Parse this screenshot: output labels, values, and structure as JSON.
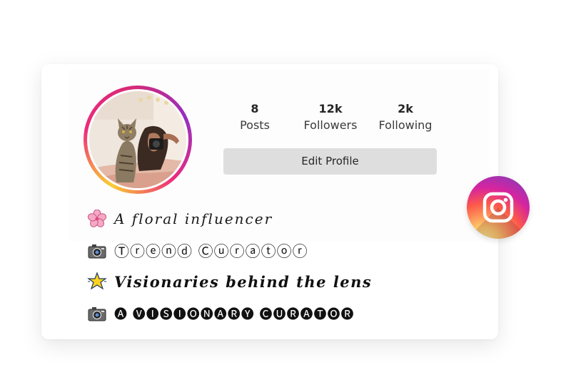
{
  "profile": {
    "stats": [
      {
        "value": "8",
        "label": "Posts"
      },
      {
        "value": "12k",
        "label": "Followers"
      },
      {
        "value": "2k",
        "label": "Following"
      }
    ],
    "edit_button_label": "Edit Profile",
    "avatar_ring_colors": [
      "#f9ce34",
      "#ee2a7b",
      "#962fbf"
    ]
  },
  "bio": {
    "lines": [
      {
        "icon": "cherry-blossom-icon",
        "text": "A floral influencer"
      },
      {
        "icon": "camera-icon",
        "text": "Ⓣⓡⓔⓝⓓ Ⓒⓤⓡⓐⓣⓞⓡ"
      },
      {
        "icon": "glowing-star-icon",
        "text": "Visionaries behind the lens"
      },
      {
        "icon": "camera-icon",
        "text": "🅐 🅥🅘🅢🅘🅞🅝🅐🅡🅨 🅒🅤🅡🅐🅣🅞🅡"
      }
    ]
  },
  "brand": {
    "icon": "instagram-logo-icon",
    "colors": [
      "#fdf497",
      "#fd5949",
      "#d6249f",
      "#8a3ab9"
    ]
  }
}
